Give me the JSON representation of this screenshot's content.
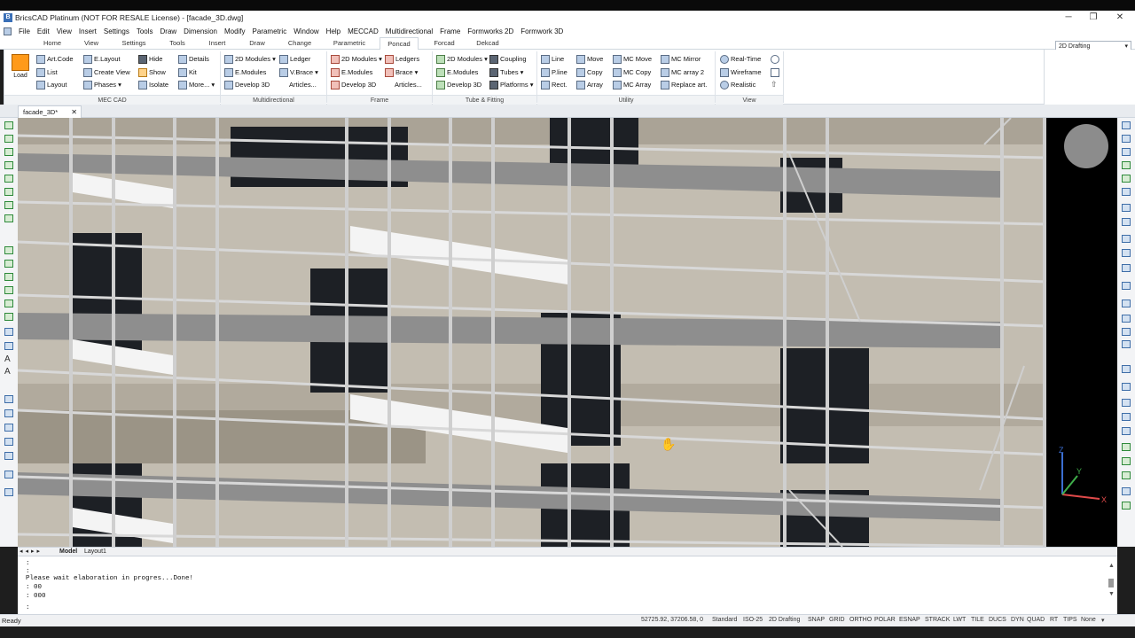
{
  "app": {
    "title": "BricsCAD Platinum (NOT FOR RESALE License) - [facade_3D.dwg]",
    "icon": "bricscad-logo-icon"
  },
  "window_controls": {
    "minimize": "─",
    "restore": "❐",
    "close": "✕"
  },
  "menu": [
    "File",
    "Edit",
    "View",
    "Insert",
    "Settings",
    "Tools",
    "Draw",
    "Dimension",
    "Modify",
    "Parametric",
    "Window",
    "Help",
    "MECCAD",
    "Multidirectional",
    "Frame",
    "Formworks 2D",
    "Formwork 3D"
  ],
  "ribbon_tabs": [
    "Home",
    "View",
    "Settings",
    "Tools",
    "Insert",
    "Draw",
    "Change",
    "Parametric",
    "Poncad",
    "Forcad",
    "Dekcad"
  ],
  "active_tab": "Poncad",
  "workspace": "2D Drafting",
  "ribbon": {
    "load": "Load",
    "panels": [
      "MEC CAD",
      "Multidirectional",
      "Frame",
      "Tube & Fitting",
      "Utility",
      "View"
    ],
    "meccad": [
      "Art.Code",
      "E.Layout",
      "Hide",
      "Details",
      "List",
      "Create View",
      "Show",
      "Kit",
      "Layout",
      "Phases",
      "Isolate",
      "More..."
    ],
    "multidirectional": [
      "2D Modules",
      "Ledger",
      "E.Modules",
      "V.Brace",
      "Develop 3D",
      "Articles..."
    ],
    "frame": [
      "2D Modules",
      "Ledgers",
      "E.Modules",
      "Brace",
      "Develop 3D",
      "Articles..."
    ],
    "tube": [
      "2D Modules",
      "Coupling",
      "E.Modules",
      "Tubes",
      "Develop 3D",
      "Platforms"
    ],
    "utility": [
      "Line",
      "Move",
      "MC Move",
      "MC Mirror",
      "P.line",
      "Copy",
      "MC Copy",
      "MC array 2",
      "Rect.",
      "Array",
      "MC Array",
      "Replace art."
    ],
    "view": [
      "Real-Time",
      "Wireframe",
      "Realistic"
    ]
  },
  "document_tab": "facade_3D*",
  "layout_tabs": [
    "Model",
    "Layout1"
  ],
  "command_lines": [
    ":",
    ":",
    "Please wait elaboration in progres...Done!",
    ": 00",
    ": 000",
    ":"
  ],
  "status": {
    "ready": "Ready",
    "coords": "52725.92, 37206.58, 0",
    "items": [
      "Standard",
      "ISO-25",
      "2D Drafting",
      "SNAP",
      "GRID",
      "ORTHO",
      "POLAR",
      "ESNAP",
      "STRACK",
      "LWT",
      "TILE",
      "DUCS",
      "DYN",
      "QUAD",
      "RT",
      "TIPS",
      "None"
    ]
  },
  "ucs": {
    "x": "X",
    "y": "Y",
    "z": "Z"
  }
}
